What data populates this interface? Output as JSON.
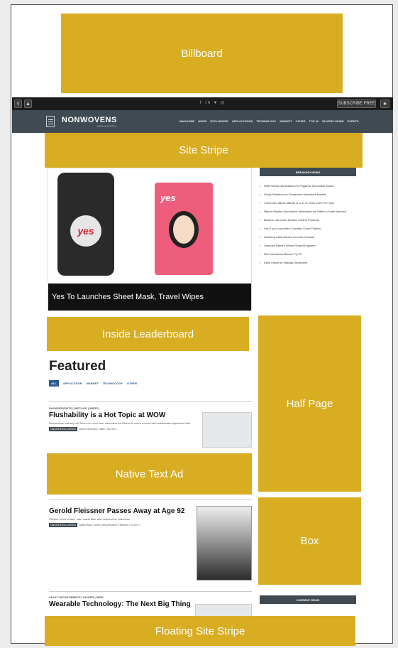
{
  "ads": {
    "billboard": "Billboard",
    "site_stripe": "Site Stripe",
    "inside_leaderboard": "Inside Leaderboard",
    "half_page": "Half Page",
    "native_text_ad": "Native Text Ad",
    "box": "Box",
    "floating_site_stripe": "Floating Site Stripe"
  },
  "topbar": {
    "subscribe_label": "SUBSCRIBE FREE",
    "social": "f  in  ♥  ◎"
  },
  "nav": {
    "logo": "NONWOVENS",
    "logo_sub": "INDUSTRY",
    "links": [
      "MAGAZINE",
      "NEWS",
      "EXCLUSIVES",
      "APPLICATIONS",
      "TECHNOLOGY",
      "MARKET",
      "OTHER",
      "TOP 40",
      "BUYERS GUIDE",
      "EVENTS"
    ]
  },
  "hero": {
    "caption": "Yes To Launches Sheet Mask, Travel Wipes",
    "brand1": "yes",
    "brand2": "yes"
  },
  "sidebar": {
    "breaking_title": "BREAKING NEWS",
    "items": [
      "NSM Seeks Nominations for Hygienic Innovation Award",
      "Study Published on Nonwoven Adhesives Market",
      "Consumer Wipes Market in U.S. to Grow 3.5% Per Year",
      "Report Studies Automotive Airbrushed for Filters in North America",
      "Mazzini Launches Tension Control Products",
      "Yes & you Launches Cosmetic Cover Fabrics",
      "Kimberly-Clark Names General Counsel",
      "Sandoze Names Senior Project Engineer",
      "R&J Introduces Breeze Fly Fit",
      "Early Listed on Nasdaq Stockholm"
    ],
    "current_issue_title": "CURRENT ISSUE"
  },
  "featured": {
    "title": "Featured",
    "filters": [
      "ALL",
      "APPLICATION",
      "MARKET",
      "TECHNOLOGY",
      "OTHER"
    ]
  },
  "articles": [
    {
      "category": "SHOWS/EVENTS | WETLAID | WIPES",
      "title": "Flushability is a Hot Topic at WOW",
      "desc": "Nonwovens industry will focus on consumer education as efforts to march accord with wastewater agencies lead",
      "badge": "ONLINE EXCLUSIVES",
      "byline": "Karen Mclimans, editor  •  04.25.17"
    },
    {
      "category": "",
      "title": "Gerold Fleissner Passes Away at Age 92",
      "desc": "Pioneer of the textile, man-made fiber and nonwovens industries",
      "badge": "ONLINE EXCLUSIVES",
      "byline": "Mitzel Bieto, former vice president, Fleissner  •  04.25.17"
    },
    {
      "category": "ADULT INCONTINENCE | DIAPER | WIPE",
      "title": "Wearable Technology: The Next Big Thing"
    }
  ]
}
